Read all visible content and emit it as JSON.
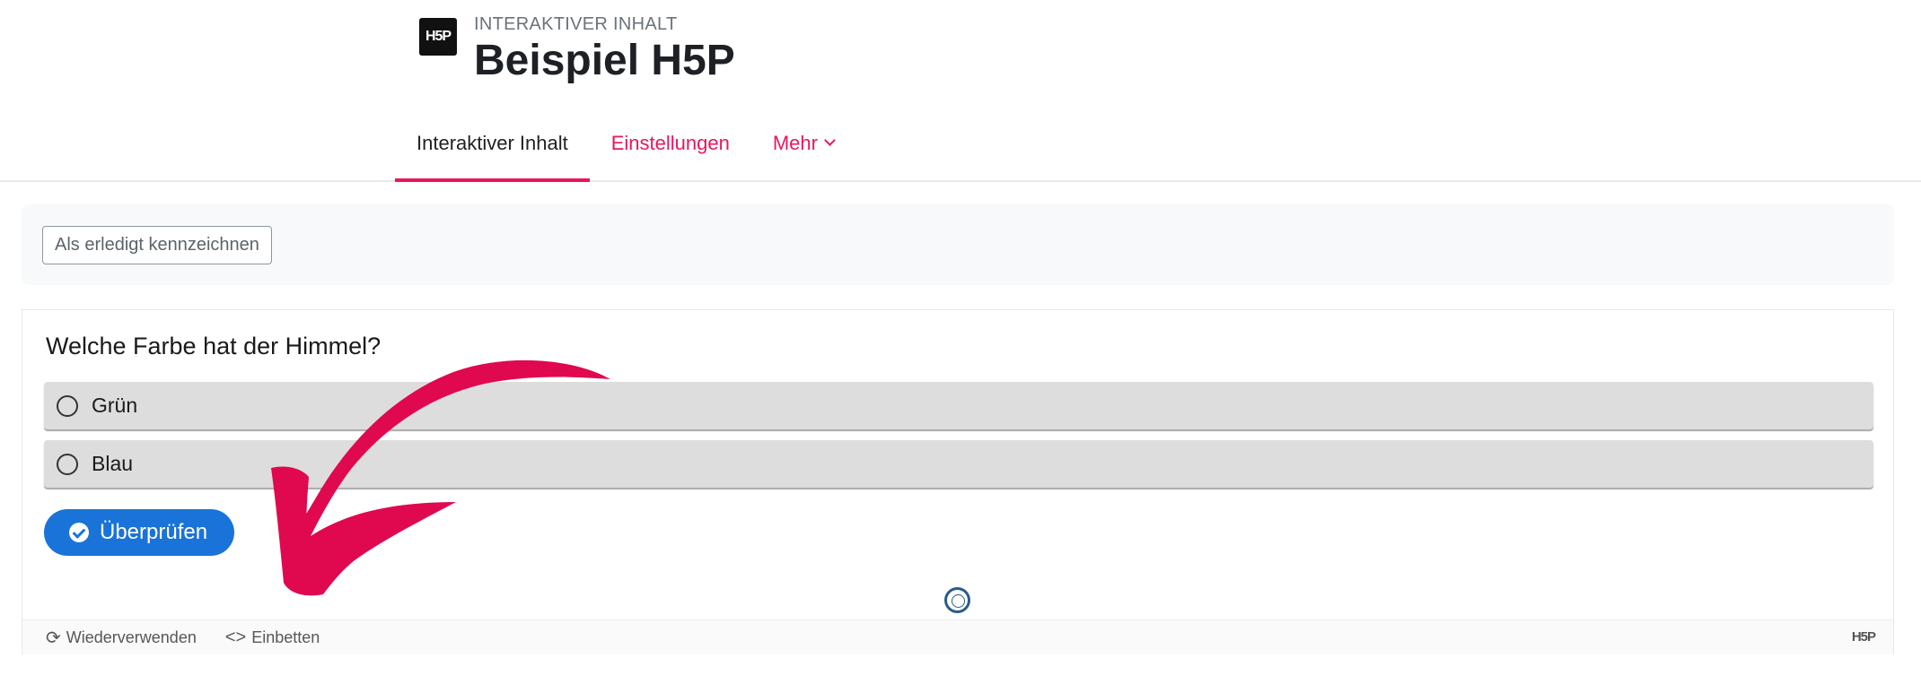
{
  "header": {
    "icon_label": "H5P",
    "activity_type": "INTERAKTIVER INHALT",
    "title": "Beispiel H5P"
  },
  "nav": {
    "tabs": [
      {
        "label": "Interaktiver Inhalt",
        "active": true
      },
      {
        "label": "Einstellungen",
        "active": false
      },
      {
        "label": "Mehr",
        "active": false,
        "has_dropdown": true
      }
    ]
  },
  "completion": {
    "button_label": "Als erledigt kennzeichnen"
  },
  "h5p": {
    "question": "Welche Farbe hat der Himmel?",
    "answers": [
      {
        "label": "Grün"
      },
      {
        "label": "Blau"
      }
    ],
    "check_button_label": "Überprüfen",
    "footer": {
      "reuse_label": "Wiederverwenden",
      "embed_label": "Einbetten",
      "logo": "H5P"
    }
  },
  "colors": {
    "accent": "#e8175d",
    "primary_button": "#1a73d9",
    "annotation_arrow": "#e0084f"
  },
  "icons": [
    "h5p-logo-icon",
    "chevron-down-icon",
    "radio-icon",
    "check-circle-icon",
    "progress-dot-icon",
    "reuse-icon",
    "embed-icon",
    "annotation-arrow-icon"
  ]
}
